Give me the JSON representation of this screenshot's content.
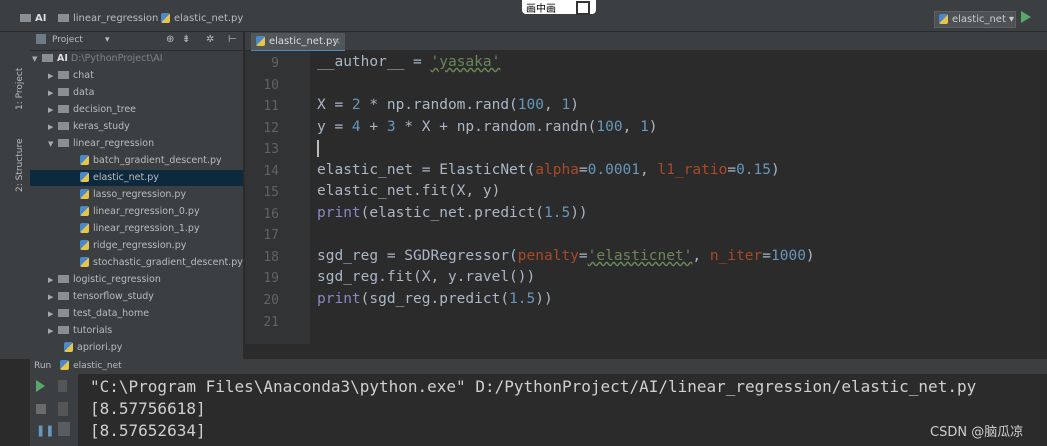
{
  "window": {
    "overlay_label": "画中画"
  },
  "breadcrumb": {
    "root": "AI",
    "folder": "linear_regression",
    "file": "elastic_net.py"
  },
  "run_config": {
    "label": "elastic_net ▾"
  },
  "project_panel": {
    "title": "Project",
    "dropdown": "▾"
  },
  "left_strip": {
    "project_label": "1: Project",
    "structure_label": "2: Structure"
  },
  "tree": {
    "root_name": "AI",
    "root_path": "D:\\PythonProject\\AI",
    "items": [
      {
        "label": "chat"
      },
      {
        "label": "data"
      },
      {
        "label": "decision_tree"
      },
      {
        "label": "keras_study"
      },
      {
        "label": "linear_regression"
      },
      {
        "label": "batch_gradient_descent.py"
      },
      {
        "label": "elastic_net.py"
      },
      {
        "label": "lasso_regression.py"
      },
      {
        "label": "linear_regression_0.py"
      },
      {
        "label": "linear_regression_1.py"
      },
      {
        "label": "ridge_regression.py"
      },
      {
        "label": "stochastic_gradient_descent.py"
      },
      {
        "label": "logistic_regression"
      },
      {
        "label": "tensorflow_study"
      },
      {
        "label": "test_data_home"
      },
      {
        "label": "tutorials"
      },
      {
        "label": "apriori.py"
      }
    ]
  },
  "editor": {
    "tab_label": "elastic_net.py",
    "line_numbers": [
      "9",
      "10",
      "11",
      "12",
      "13",
      "14",
      "15",
      "16",
      "17",
      "18",
      "19",
      "20",
      "21"
    ],
    "lines": {
      "l9": {
        "a": "__author__ = ",
        "b": "'yasaka'"
      },
      "l11": {
        "a": "X = ",
        "n1": "2",
        "b": " * np.random.rand(",
        "n2": "100",
        "c": ", ",
        "n3": "1",
        "d": ")"
      },
      "l12": {
        "a": "y = ",
        "n1": "4",
        "b": " + ",
        "n2": "3",
        "c": " * X + np.random.randn(",
        "n3": "100",
        "d": ", ",
        "n4": "1",
        "e": ")"
      },
      "l14": {
        "a": "elastic_net = ElasticNet(",
        "k1": "alpha",
        "b": "=",
        "n1": "0.0001",
        "c": ", ",
        "k2": "l1_ratio",
        "d": "=",
        "n2": "0.15",
        "e": ")"
      },
      "l15": {
        "a": "elastic_net.fit(X, y)"
      },
      "l16": {
        "p": "print",
        "a": "(elastic_net.predict(",
        "n": "1.5",
        "b": "))"
      },
      "l18": {
        "a": "sgd_reg = SGDRegressor(",
        "k1": "penalty",
        "b": "=",
        "s1": "'elasticnet'",
        "c": ", ",
        "k2": "n_iter",
        "d": "=",
        "n": "1000",
        "e": ")"
      },
      "l19": {
        "a": "sgd_reg.fit(X, y.ravel())"
      },
      "l20": {
        "p": "print",
        "a": "(sgd_reg.predict(",
        "n": "1.5",
        "b": "))"
      }
    }
  },
  "run_panel": {
    "label": "Run",
    "config": "elastic_net",
    "output": [
      "\"C:\\Program Files\\Anaconda3\\python.exe\" D:/PythonProject/AI/linear_regression/elastic_net.py",
      "[8.57756618]",
      "[8.57652634]"
    ]
  },
  "watermark": "CSDN @脑瓜凉",
  "colors": {
    "keyword": "#aa4926",
    "number": "#6897bb",
    "string": "#6a8759",
    "builtin": "#8888c6",
    "selection": "#0d293e"
  }
}
